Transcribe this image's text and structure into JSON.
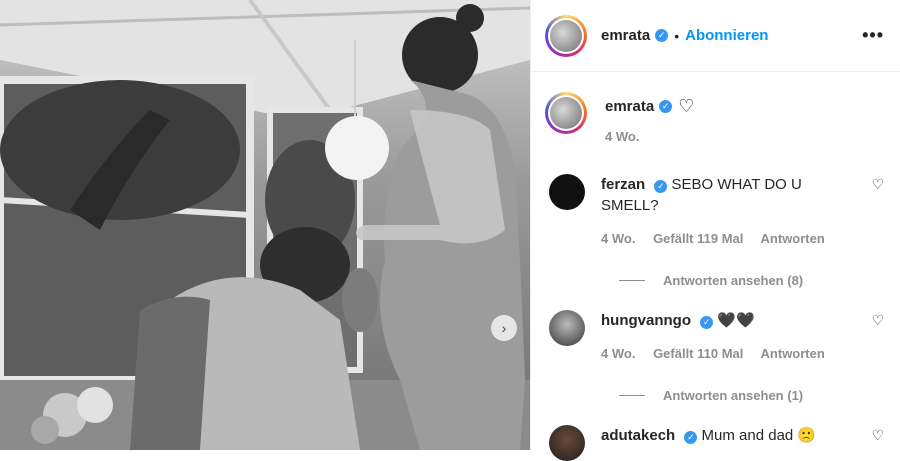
{
  "post": {
    "username": "emrata",
    "follow_label": "Abonnieren",
    "dot": "•",
    "more_label": "•••",
    "caption_time": "4 Wo."
  },
  "comments": [
    {
      "username": "ferzan",
      "text": "SEBO WHAT DO U SMELL?",
      "time": "4 Wo.",
      "likes": "Gefällt 119 Mal",
      "reply": "Antworten",
      "view_replies": "Antworten ansehen (8)"
    },
    {
      "username": "hungvanngo",
      "text": "🖤🖤",
      "time": "4 Wo.",
      "likes": "Gefällt 110 Mal",
      "reply": "Antworten",
      "view_replies": "Antworten ansehen (1)"
    },
    {
      "username": "adutakech",
      "text": "Mum and dad 🙁"
    }
  ],
  "icons": {
    "verified": "✓",
    "heart": "♡",
    "next": "›"
  },
  "colors": {
    "link_blue": "#0095f6",
    "verified_blue": "#3897f0",
    "muted": "#8e8e8e"
  }
}
